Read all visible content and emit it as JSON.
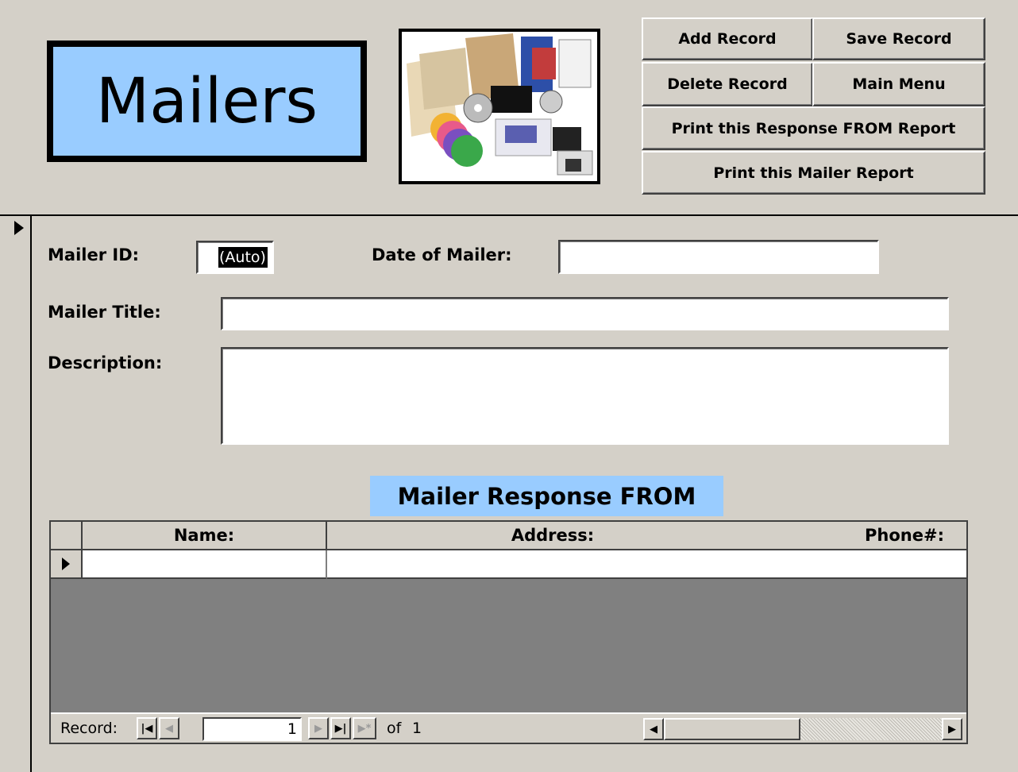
{
  "form": {
    "title": "Mailers",
    "photo": "mailer-products-photo"
  },
  "toolbar": {
    "add_record": "Add Record",
    "save_record": "Save Record",
    "delete_record": "Delete Record",
    "main_menu": "Main Menu",
    "print_response_report": "Print this Response FROM Report",
    "print_mailer_report": "Print this Mailer Report"
  },
  "fields": {
    "mailer_id_label": "Mailer ID:",
    "mailer_id_value": "(Auto)",
    "date_label": "Date of Mailer:",
    "date_value": "",
    "title_label": "Mailer Title:",
    "title_value": "",
    "description_label": "Description:",
    "description_value": ""
  },
  "subform": {
    "title": "Mailer Response FROM",
    "columns": [
      "Name:",
      "Address:",
      "Phone#:"
    ],
    "rows": [
      [
        "",
        "",
        ""
      ]
    ]
  },
  "navigation": {
    "record_label": "Record:",
    "current": "1",
    "of_label": "of",
    "total": "1",
    "icons": [
      "first-record-icon",
      "prev-record-icon",
      "next-record-icon",
      "last-record-icon",
      "new-record-icon"
    ]
  },
  "colors": {
    "background": "#d4d0c8",
    "accent": "#99ccff",
    "empty_grid": "#808080"
  }
}
